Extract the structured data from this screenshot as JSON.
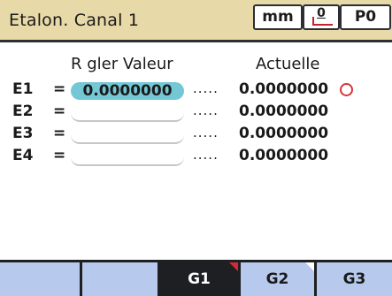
{
  "title": "Etalon. Canal 1",
  "toolbar": {
    "units": "mm",
    "reference": "0",
    "preset": "P0"
  },
  "headers": {
    "set_value": "R gler Valeur",
    "actual": "Actuelle"
  },
  "rows": [
    {
      "label": "E1",
      "eq": "=",
      "set_value": "0.0000000",
      "dots": ".....",
      "actual": "0.0000000",
      "active": true
    },
    {
      "label": "E2",
      "eq": "=",
      "set_value": "",
      "dots": ".....",
      "actual": "0.0000000",
      "active": false
    },
    {
      "label": "E3",
      "eq": "=",
      "set_value": "",
      "dots": ".....",
      "actual": "0.0000000",
      "active": false
    },
    {
      "label": "E4",
      "eq": "=",
      "set_value": "",
      "dots": ".....",
      "actual": "0.0000000",
      "active": false
    }
  ],
  "softkeys": [
    "",
    "",
    "G1",
    "G2",
    "G3"
  ],
  "colors": {
    "titlebar": "#e8d9a8",
    "active_field": "#74c8d6",
    "softkey": "#b7c9ec",
    "marker": "#d62a36"
  },
  "icons": {
    "status": "circle-outline-icon",
    "reference": "reference-zero-icon"
  }
}
